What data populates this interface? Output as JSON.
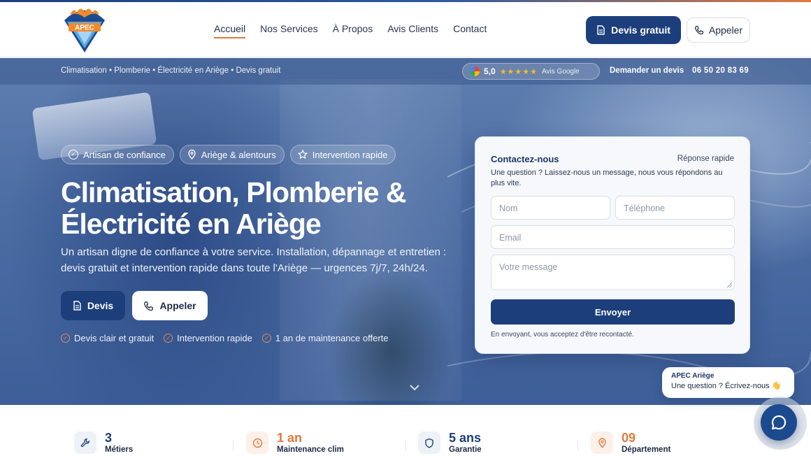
{
  "brand": {
    "logo_text": "APEC",
    "colors": {
      "primary": "#1c3f7c",
      "accent": "#e07a3a"
    }
  },
  "nav": {
    "items": [
      {
        "label": "Accueil",
        "active": true
      },
      {
        "label": "Nos Services",
        "active": false
      },
      {
        "label": "À Propos",
        "active": false
      },
      {
        "label": "Avis Clients",
        "active": false
      },
      {
        "label": "Contact",
        "active": false
      }
    ],
    "cta_devis": "Devis gratuit",
    "cta_appeler": "Appeler"
  },
  "subbar": {
    "crumb": "Climatisation • Plomberie • Électricité en Ariège • Devis gratuit",
    "rating_score": "5,0",
    "rating_stars": "★★★★★",
    "rating_source": "Avis Google",
    "ask_quote": "Demander un devis",
    "phone": "06 50 20 83 69"
  },
  "hero": {
    "chips": [
      "Artisan de confiance",
      "Ariège & alentours",
      "Intervention rapide"
    ],
    "title_line1": "Climatisation, Plomberie &",
    "title_line2": "Électricité en Ariège",
    "lead": "Un artisan digne de confiance à votre service. Installation, dépannage et entretien : devis gratuit et intervention rapide dans toute l'Ariège — urgences 7j/7, 24h/24.",
    "btn_devis": "Devis",
    "btn_appeler": "Appeler",
    "checks": [
      "Devis clair et gratuit",
      "Intervention rapide",
      "1 an de maintenance offerte"
    ]
  },
  "form": {
    "title": "Contactez-nous",
    "badge": "Réponse rapide",
    "description": "Une question ? Laissez-nous un message, nous vous répondons au plus vite.",
    "placeholders": {
      "name": "Nom",
      "phone": "Téléphone",
      "email": "Email",
      "message": "Votre message"
    },
    "submit": "Envoyer",
    "legal": "En envoyant, vous acceptez d'être recontacté."
  },
  "stats": [
    {
      "value": "3",
      "label": "Métiers",
      "icon": "wrench-icon",
      "color": "#1c3f7c"
    },
    {
      "value": "1 an",
      "label": "Maintenance clim",
      "icon": "clock-icon",
      "color": "#e07a3a"
    },
    {
      "value": "5 ans",
      "label": "Garantie",
      "icon": "shield-icon",
      "color": "#1c3f7c"
    },
    {
      "value": "09",
      "label": "Département",
      "icon": "location-pin-icon",
      "color": "#e07a3a"
    }
  ],
  "chat": {
    "title": "APEC Ariège",
    "message": "Une question ? Écrivez-nous 👋"
  }
}
